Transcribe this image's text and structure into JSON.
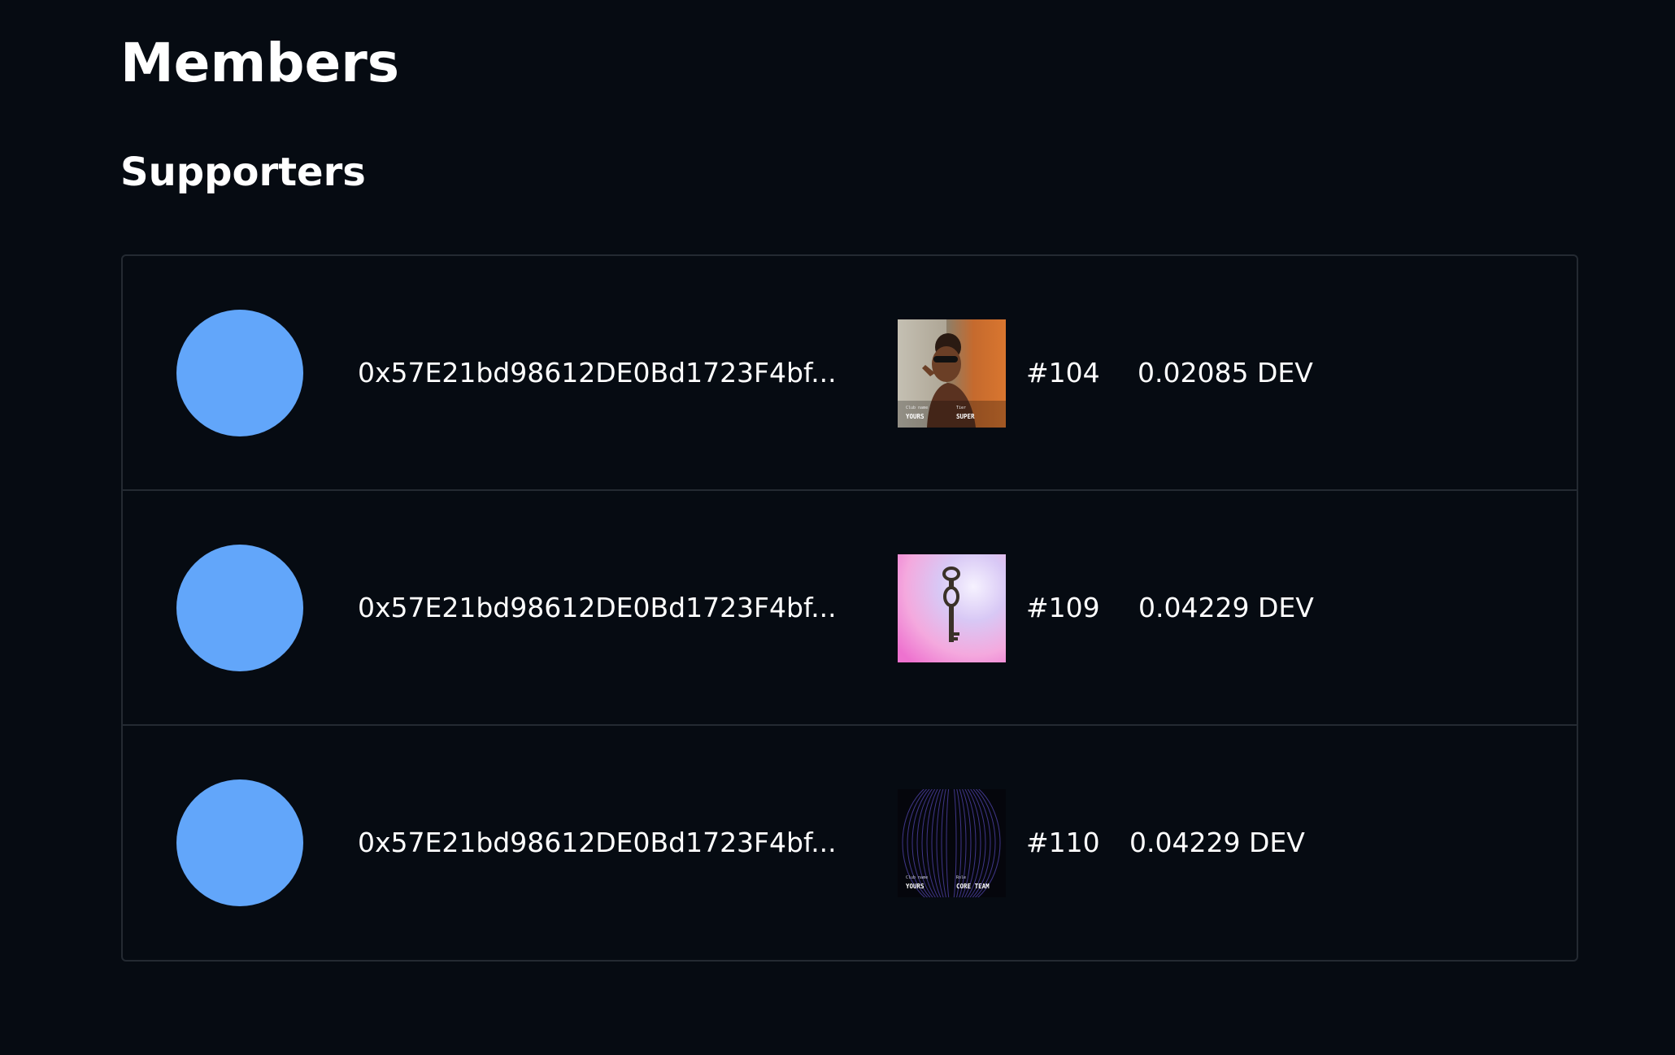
{
  "page": {
    "title": "Members",
    "section_title": "Supporters"
  },
  "colors": {
    "background": "#060b12",
    "avatar": "#62a6fa",
    "border": "#242a32",
    "text": "#ffffff"
  },
  "supporters": [
    {
      "address": "0x57E21bd98612DE0Bd1723F4bf...",
      "token_id": "#104",
      "amount": "0.02085 DEV",
      "nft": {
        "club_caption": "Club name",
        "club_value": "YOURS",
        "tier_caption": "Tier",
        "tier_value": "SUPER"
      }
    },
    {
      "address": "0x57E21bd98612DE0Bd1723F4bf...",
      "token_id": "#109",
      "amount": "0.04229 DEV",
      "nft": {}
    },
    {
      "address": "0x57E21bd98612DE0Bd1723F4bf...",
      "token_id": "#110",
      "amount": "0.04229 DEV",
      "nft": {
        "club_caption": "Club name",
        "club_value": "YOURS",
        "role_caption": "Role",
        "role_value": "CORE TEAM"
      }
    }
  ]
}
